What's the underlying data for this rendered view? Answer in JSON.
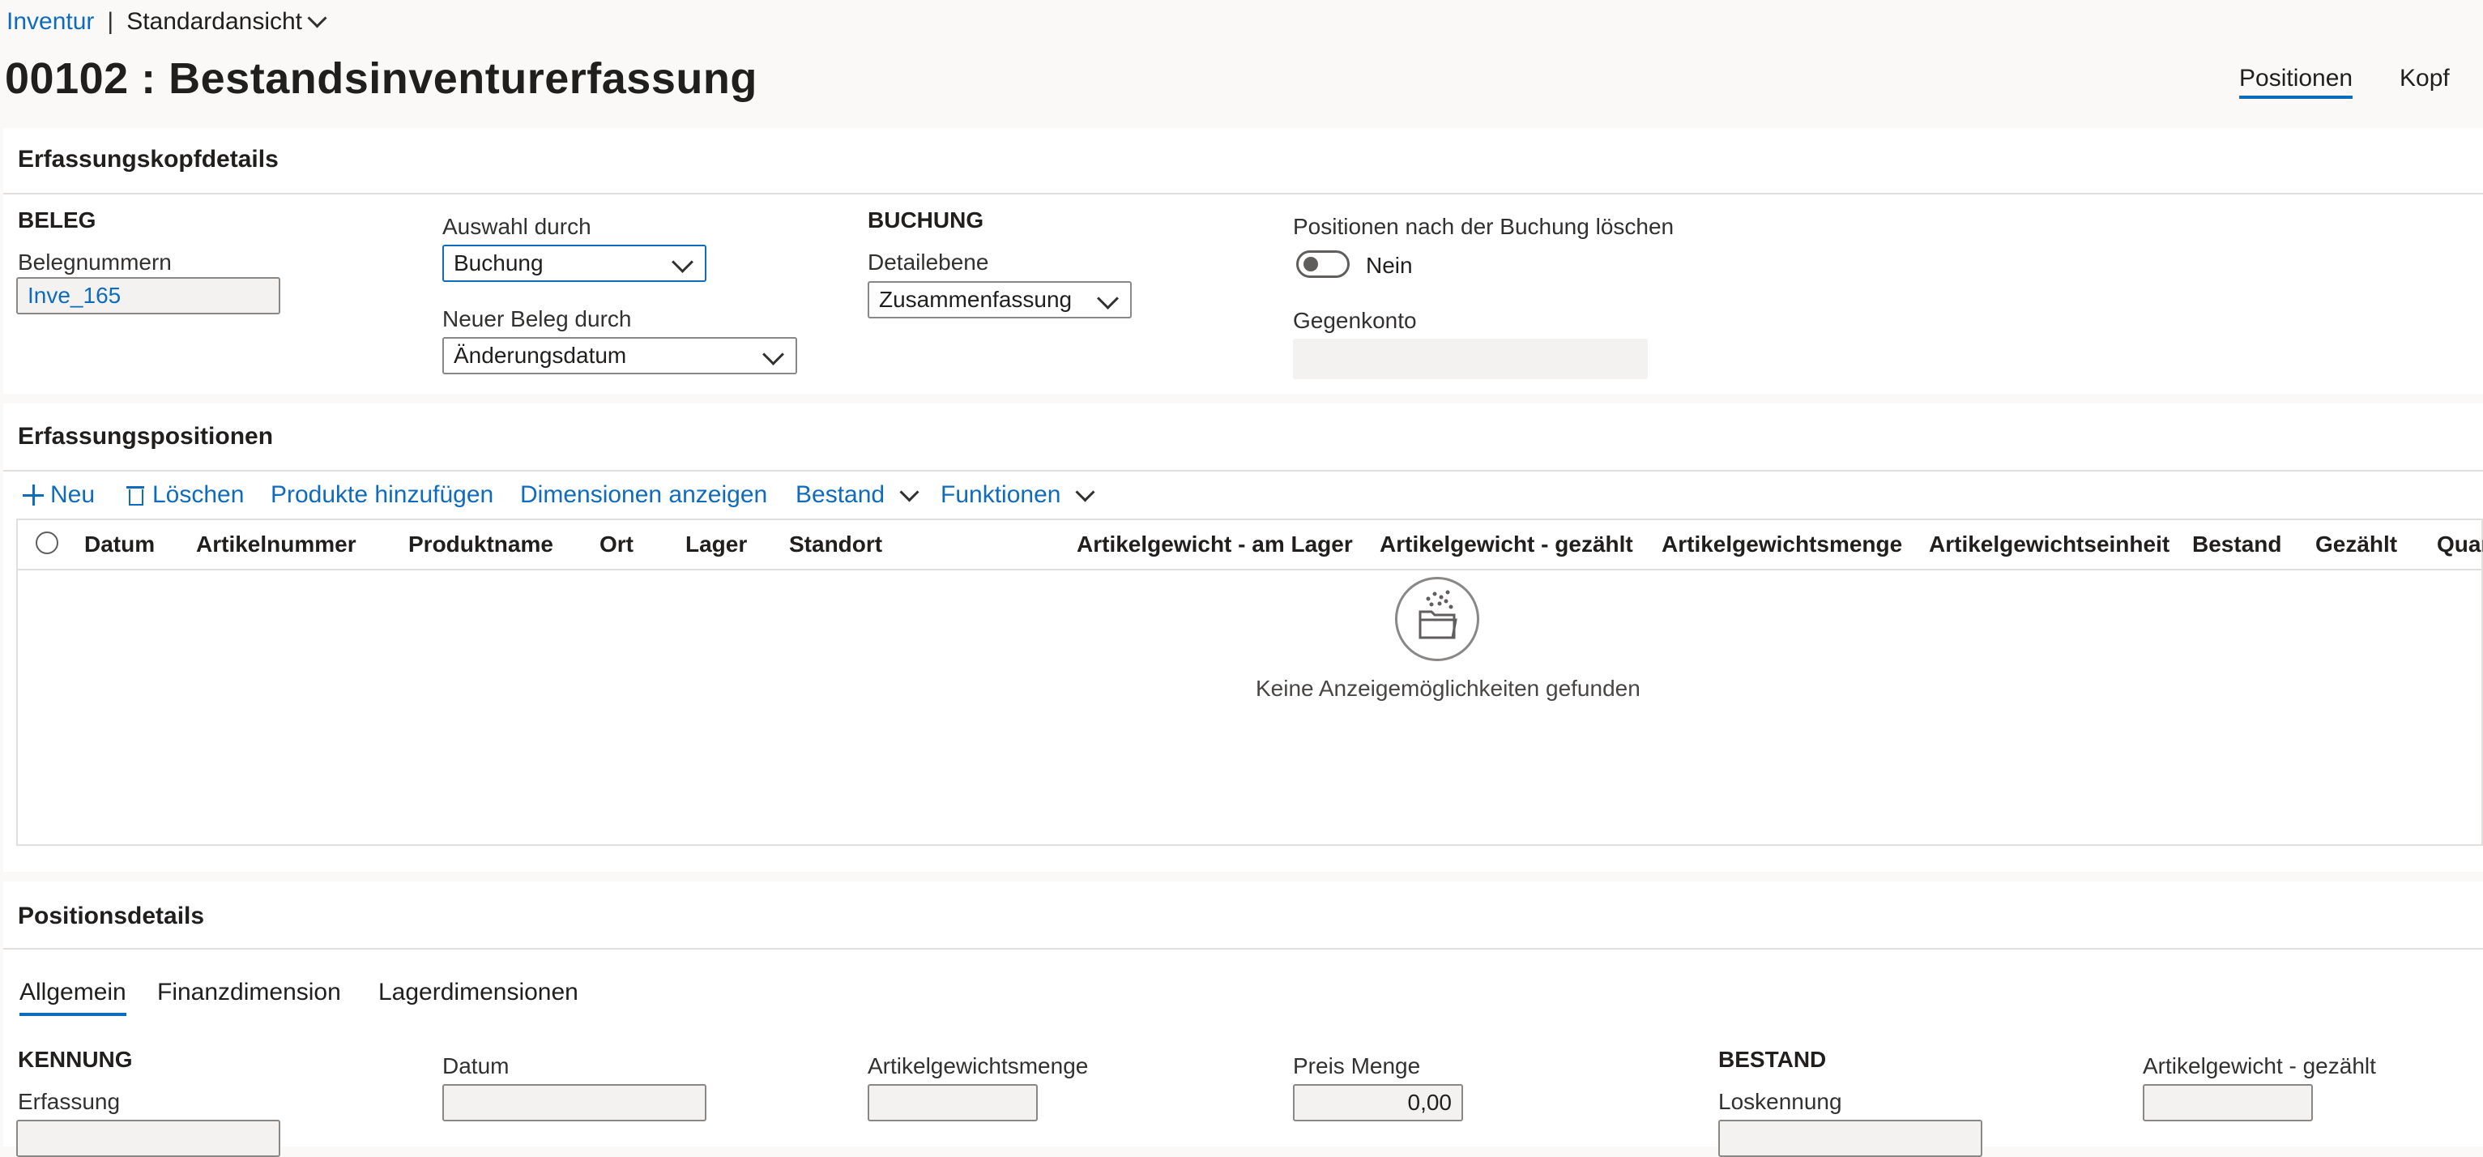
{
  "breadcrumb": {
    "root": "Inventur",
    "separator": "|",
    "view": "Standardansicht"
  },
  "page_title": "00102 : Bestandsinventurerfassung",
  "top_tabs": {
    "positions": "Positionen",
    "header": "Kopf"
  },
  "header_section": {
    "title": "Erfassungskopfdetails",
    "beleg_group": "BELEG",
    "voucher_label": "Belegnummern",
    "voucher_value": "Inve_165",
    "selection_label": "Auswahl durch",
    "selection_value": "Buchung",
    "new_voucher_label": "Neuer Beleg durch",
    "new_voucher_value": "Änderungsdatum",
    "posting_group": "BUCHUNG",
    "detail_label": "Detailebene",
    "detail_value": "Zusammenfassung",
    "delete_label": "Positionen nach der Buchung löschen",
    "delete_value": "Nein",
    "offset_label": "Gegenkonto",
    "offset_value": ""
  },
  "lines_section": {
    "title": "Erfassungspositionen",
    "toolbar": {
      "new": "Neu",
      "delete": "Löschen",
      "add_products": "Produkte hinzufügen",
      "show_dimensions": "Dimensionen anzeigen",
      "inventory": "Bestand",
      "functions": "Funktionen"
    },
    "columns": [
      "Datum",
      "Artikelnummer",
      "Produktname",
      "Ort",
      "Lager",
      "Standort",
      "Artikelgewicht - am Lager",
      "Artikelgewicht - gezählt",
      "Artikelgewichtsmenge",
      "Artikelgewichtseinheit",
      "Bestand",
      "Gezählt",
      "Quar"
    ],
    "empty_message": "Keine Anzeigemöglichkeiten gefunden"
  },
  "details_section": {
    "title": "Positionsdetails",
    "tabs": [
      "Allgemein",
      "Finanzdimension",
      "Lagerdimensionen"
    ],
    "id_group": "KENNUNG",
    "journal_label": "Erfassung",
    "journal_value": "",
    "date_label": "Datum",
    "date_value": "",
    "catch_weight_qty_label": "Artikelgewichtsmenge",
    "catch_weight_qty_value": "",
    "price_qty_label": "Preis Menge",
    "price_qty_value": "0,00",
    "inventory_group": "BESTAND",
    "lot_label": "Loskennung",
    "lot_value": "",
    "counted_weight_label": "Artikelgewicht - gezählt",
    "counted_weight_value": ""
  },
  "colors": {
    "accent": "#0f6cbd",
    "background": "#faf9f8",
    "card": "#ffffff",
    "border": "#e1dfdd"
  },
  "icons": [
    "chevron-down-icon",
    "plus-icon",
    "trash-icon",
    "radio-icon",
    "empty-folder-icon",
    "toggle-icon"
  ]
}
